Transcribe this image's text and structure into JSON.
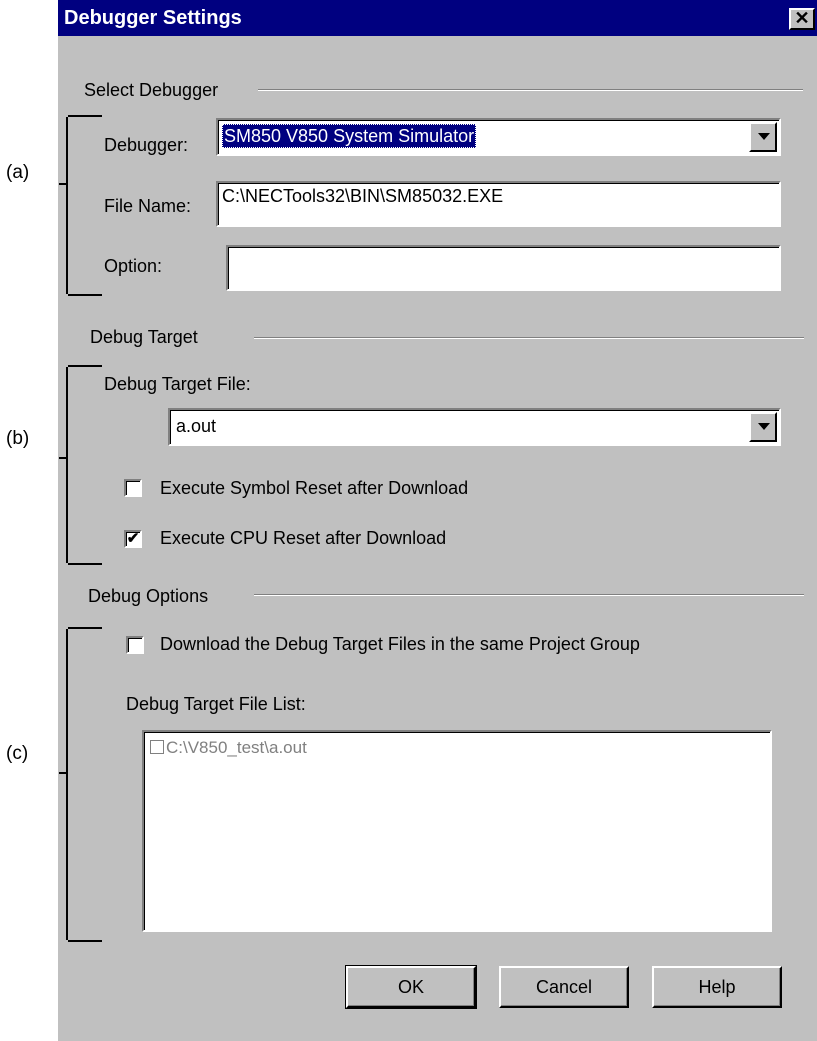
{
  "annotations": [
    "(a)",
    "(b)",
    "(c)"
  ],
  "window": {
    "title": "Debugger Settings",
    "close_glyph": "✕"
  },
  "select_debugger": {
    "group_label": "Select Debugger",
    "debugger_label": "Debugger:",
    "debugger_value": "SM850 V850 System Simulator",
    "filename_label": "File Name:",
    "filename_value": "C:\\NECTools32\\BIN\\SM85032.EXE",
    "option_label": "Option:",
    "option_value": ""
  },
  "debug_target": {
    "group_label": "Debug Target",
    "file_label": "Debug Target File:",
    "file_value": "a.out",
    "symbol_reset_label": "Execute Symbol Reset after Download",
    "symbol_reset_checked": false,
    "cpu_reset_label": "Execute CPU Reset after Download",
    "cpu_reset_checked": true
  },
  "debug_options": {
    "group_label": "Debug Options",
    "download_label": "Download the Debug Target Files in the same Project Group",
    "download_checked": false,
    "list_label": "Debug Target File List:",
    "list_items": [
      "C:\\V850_test\\a.out"
    ]
  },
  "buttons": {
    "ok": "OK",
    "cancel": "Cancel",
    "help": "Help"
  }
}
